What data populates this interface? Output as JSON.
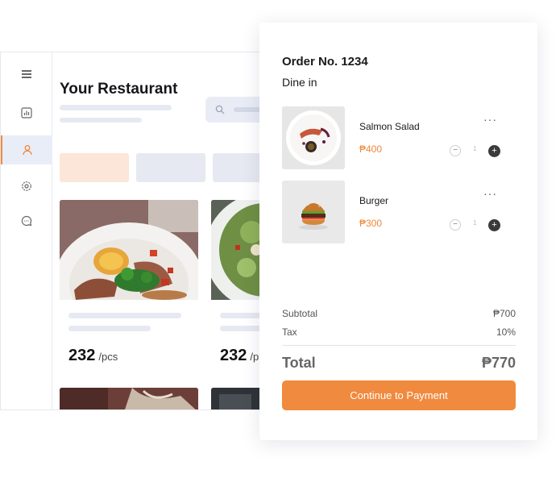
{
  "app": {
    "title": "Your Restaurant",
    "sidebar": {
      "items": [
        {
          "icon": "menu-icon"
        },
        {
          "icon": "chart-icon"
        },
        {
          "icon": "user-icon",
          "active": true
        },
        {
          "icon": "gear-icon"
        },
        {
          "icon": "chat-icon"
        }
      ]
    },
    "products": [
      {
        "price": "232",
        "unit": "/pcs"
      },
      {
        "price": "232",
        "unit": "/p"
      }
    ]
  },
  "order": {
    "number": "Order No. 1234",
    "type": "Dine in",
    "items": [
      {
        "name": "Salmon Salad",
        "price": "₱400",
        "qty": "1"
      },
      {
        "name": "Burger",
        "price": "₱300",
        "qty": "1"
      }
    ],
    "more_label": "···",
    "minus_label": "−",
    "plus_label": "+",
    "summary": {
      "subtotal_label": "Subtotal",
      "subtotal_value": "₱700",
      "tax_label": "Tax",
      "tax_value": "10%",
      "total_label": "Total",
      "total_value": "₱770"
    },
    "pay_button": "Continue to Payment"
  },
  "colors": {
    "accent": "#f08a3e",
    "skeleton": "#e6e9f1",
    "chip_active": "#fbe6d9",
    "chip": "#e6e9f1"
  }
}
